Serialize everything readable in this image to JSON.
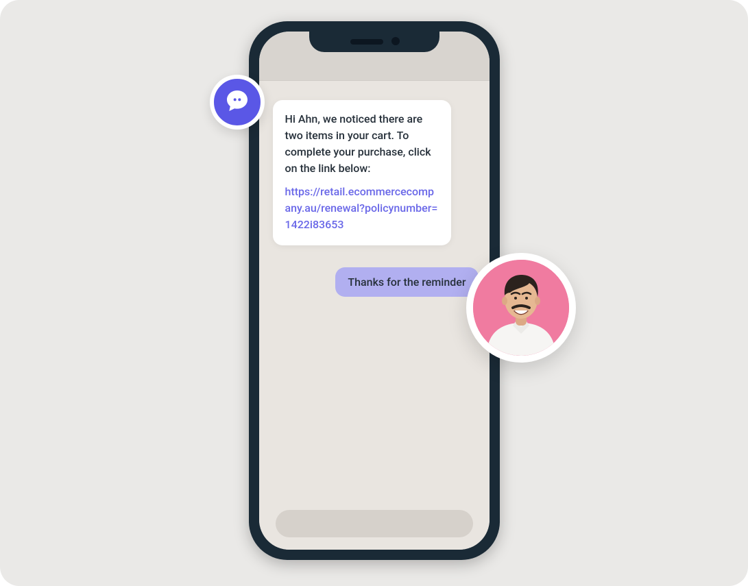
{
  "colors": {
    "canvas_bg": "#eae9e7",
    "phone_frame": "#1a2a36",
    "screen_bg": "#e9e5e0",
    "header_bg": "#d8d4cf",
    "bubble_incoming_bg": "#ffffff",
    "bubble_outgoing_bg": "#b1aff0",
    "link": "#6a68e8",
    "badge": "#5a57e6",
    "avatar_bg": "#f07ba0"
  },
  "chat": {
    "incoming": {
      "text": "Hi Ahn, we noticed there are two items in your cart. To complete your purchase, click on the link below:",
      "link_text": "https://retail.ecommercecompany.au/renewal?policynumber=1422i83653"
    },
    "outgoing": {
      "text": "Thanks for the reminder"
    }
  },
  "icons": {
    "sender": "chat-bubble-icon",
    "user": "person-avatar"
  }
}
